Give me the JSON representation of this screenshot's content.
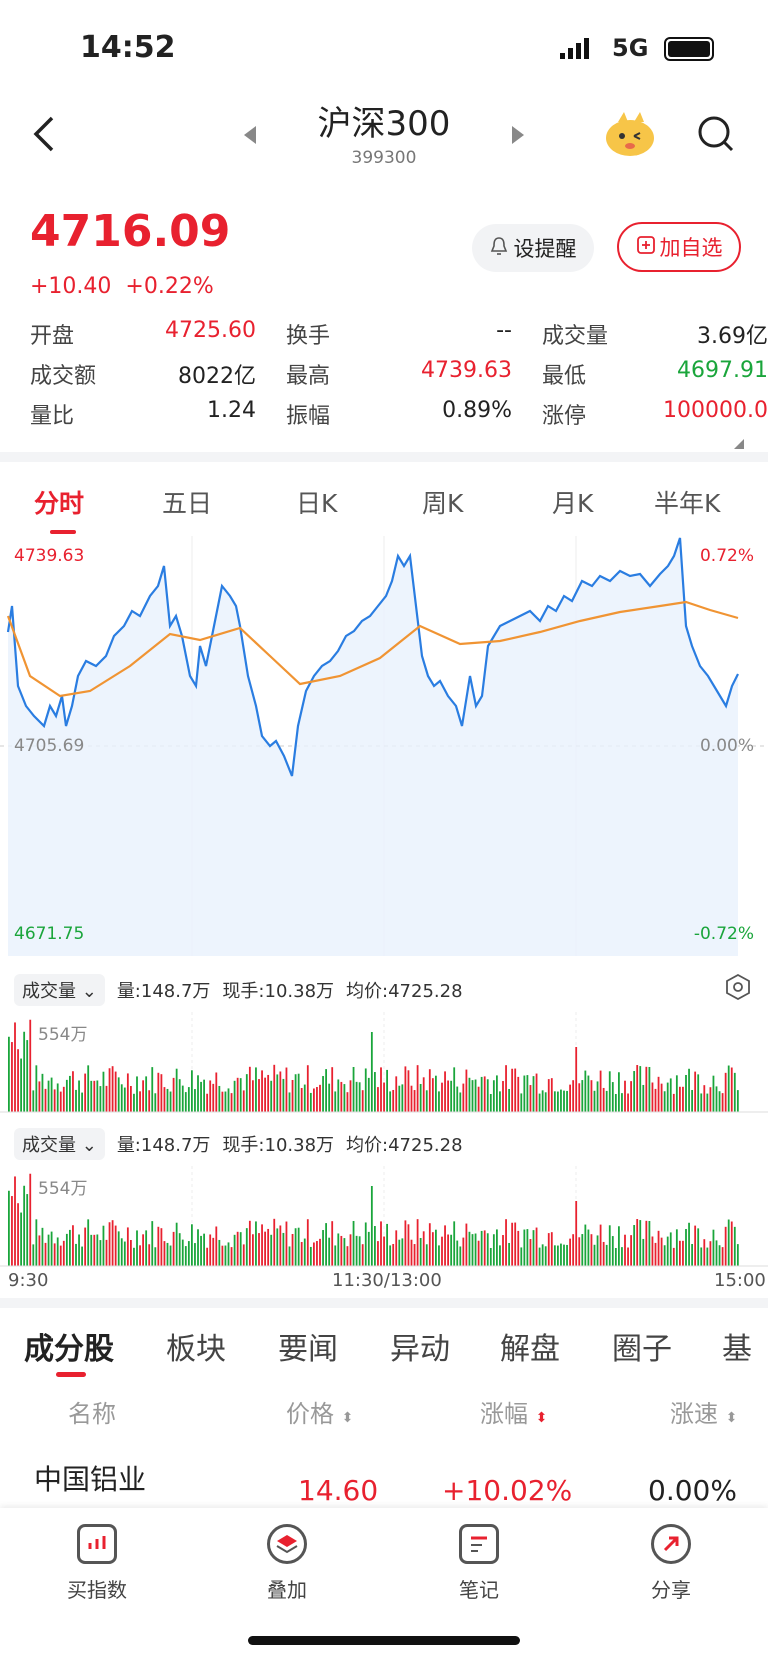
{
  "status": {
    "time": "14:52",
    "network": "5G"
  },
  "header": {
    "title": "沪深300",
    "code": "399300"
  },
  "quote": {
    "price": "4716.09",
    "change": "+10.40",
    "change_pct": "+0.22%",
    "remind_label": "设提醒",
    "add_label": "加自选"
  },
  "stats": [
    {
      "label": "开盘",
      "value": "4725.60",
      "color": "red"
    },
    {
      "label": "换手",
      "value": "--",
      "color": "black"
    },
    {
      "label": "成交量",
      "value": "3.69亿",
      "color": "black"
    },
    {
      "label": "成交额",
      "value": "8022亿",
      "color": "black"
    },
    {
      "label": "最高",
      "value": "4739.63",
      "color": "red"
    },
    {
      "label": "最低",
      "value": "4697.91",
      "color": "green"
    },
    {
      "label": "量比",
      "value": "1.24",
      "color": "black"
    },
    {
      "label": "振幅",
      "value": "0.89%",
      "color": "black"
    },
    {
      "label": "涨停",
      "value": "100000.0",
      "color": "red"
    }
  ],
  "chart_tabs": [
    "分时",
    "五日",
    "日K",
    "周K",
    "月K",
    "半年K"
  ],
  "chart": {
    "y_top": "4739.63",
    "y_mid": "4705.69",
    "y_bot": "4671.75",
    "pct_top": "0.72%",
    "pct_mid": "0.00%",
    "pct_bot": "-0.72%"
  },
  "volume": {
    "selector": "成交量",
    "info1": "量:148.7万",
    "info2": "现手:10.38万",
    "info3": "均价:4725.28",
    "max_label": "554万"
  },
  "time_axis": {
    "start": "9:30",
    "mid": "11:30/13:00",
    "end": "15:00"
  },
  "bottom_tabs": [
    "成分股",
    "板块",
    "要闻",
    "异动",
    "解盘",
    "圈子",
    "基金"
  ],
  "table": {
    "headers": [
      "名称",
      "价格",
      "涨幅",
      "涨速"
    ],
    "rows": [
      {
        "name": "中国铝业",
        "price": "14.60",
        "pct": "+10.02%",
        "speed": "0.00%"
      }
    ]
  },
  "nav": [
    "买指数",
    "叠加",
    "笔记",
    "分享"
  ],
  "colors": {
    "up": "#e8212f",
    "down": "#1aa53b",
    "price_line": "#2a7de1",
    "avg_line": "#f09433"
  }
}
